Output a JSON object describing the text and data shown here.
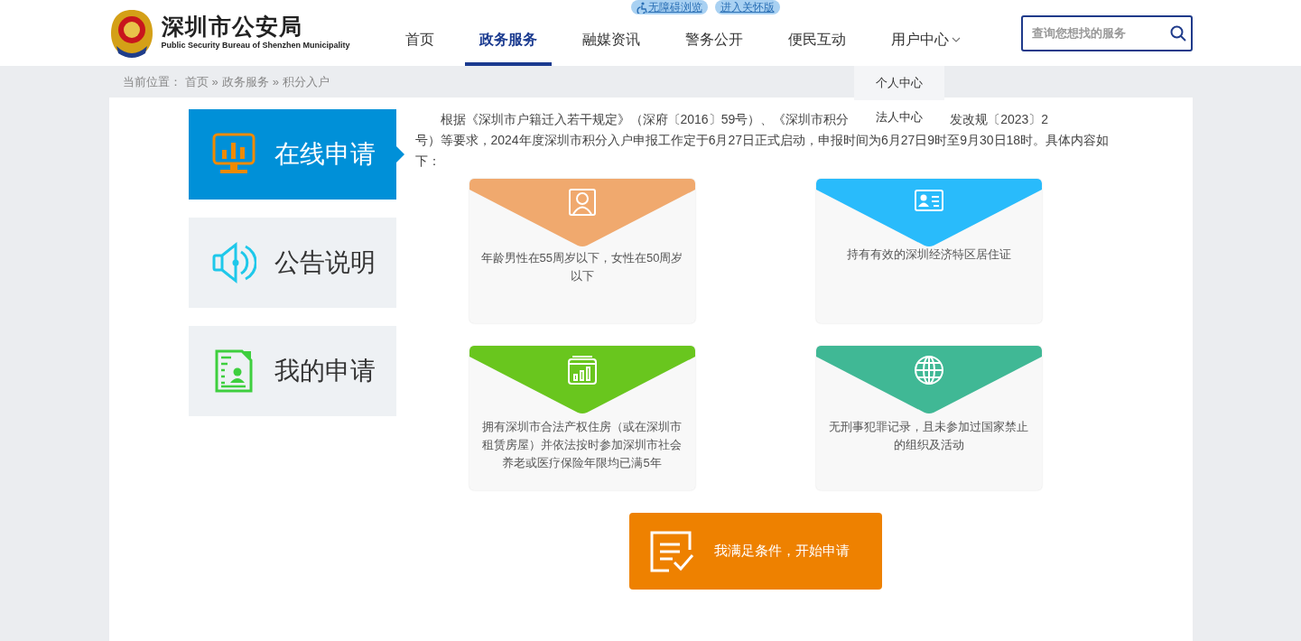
{
  "header": {
    "logo": {
      "title": "深圳市公安局",
      "subtitle": "Public Security Bureau of Shenzhen Municipality"
    },
    "quick_links": [
      {
        "label": "无障碍浏览",
        "kind": "accessibility"
      },
      {
        "label": "进入关怀版",
        "kind": "plain"
      }
    ],
    "nav": [
      {
        "label": "首页",
        "selected": false
      },
      {
        "label": "政务服务",
        "selected": true
      },
      {
        "label": "融媒资讯",
        "selected": false
      },
      {
        "label": "警务公开",
        "selected": false
      },
      {
        "label": "便民互动",
        "selected": false
      },
      {
        "label": "用户中心",
        "selected": false,
        "expanded": true,
        "menu": [
          "个人中心",
          "法人中心"
        ]
      }
    ],
    "search": {
      "placeholder": "查询您想找的服务"
    }
  },
  "breadcrumb": {
    "label": "当前位置：",
    "items": [
      {
        "label": "首页",
        "separator": "»"
      },
      {
        "label": "政务服务",
        "separator": "»"
      },
      {
        "label": "积分入户"
      }
    ]
  },
  "side_tabs": [
    {
      "label": "在线申请",
      "selected": true
    },
    {
      "label": "公告说明",
      "selected": false
    },
    {
      "label": "我的申请",
      "selected": false
    }
  ],
  "intro": {
    "before": "根据《深圳市户籍迁入若干规定》（深府〔2016〕59号）、《深圳市积分",
    "after": "发改规〔2023〕2",
    "rest": "号）等要求，2024年度深圳市积分入户申报工作定于6月27日正式启动，申报时间为6月27日9时至9月30日18时。具体内容如下："
  },
  "conditions": [
    {
      "text": "年龄男性在55周岁以下，女性在50周岁以下",
      "color": "#f0a96e"
    },
    {
      "text": "持有有效的深圳经济特区居住证",
      "color": "#29bbfb"
    },
    {
      "text": "拥有深圳市合法产权住房（或在深圳市租赁房屋）并依法按时参加深圳市社会养老或医疗保险年限均已满5年",
      "color": "#69c61e"
    },
    {
      "text": "无刑事犯罪记录，且未参加过国家禁止的组织及活动",
      "color": "#40b895"
    }
  ],
  "apply_button": {
    "label": "我满足条件，开始申请"
  }
}
